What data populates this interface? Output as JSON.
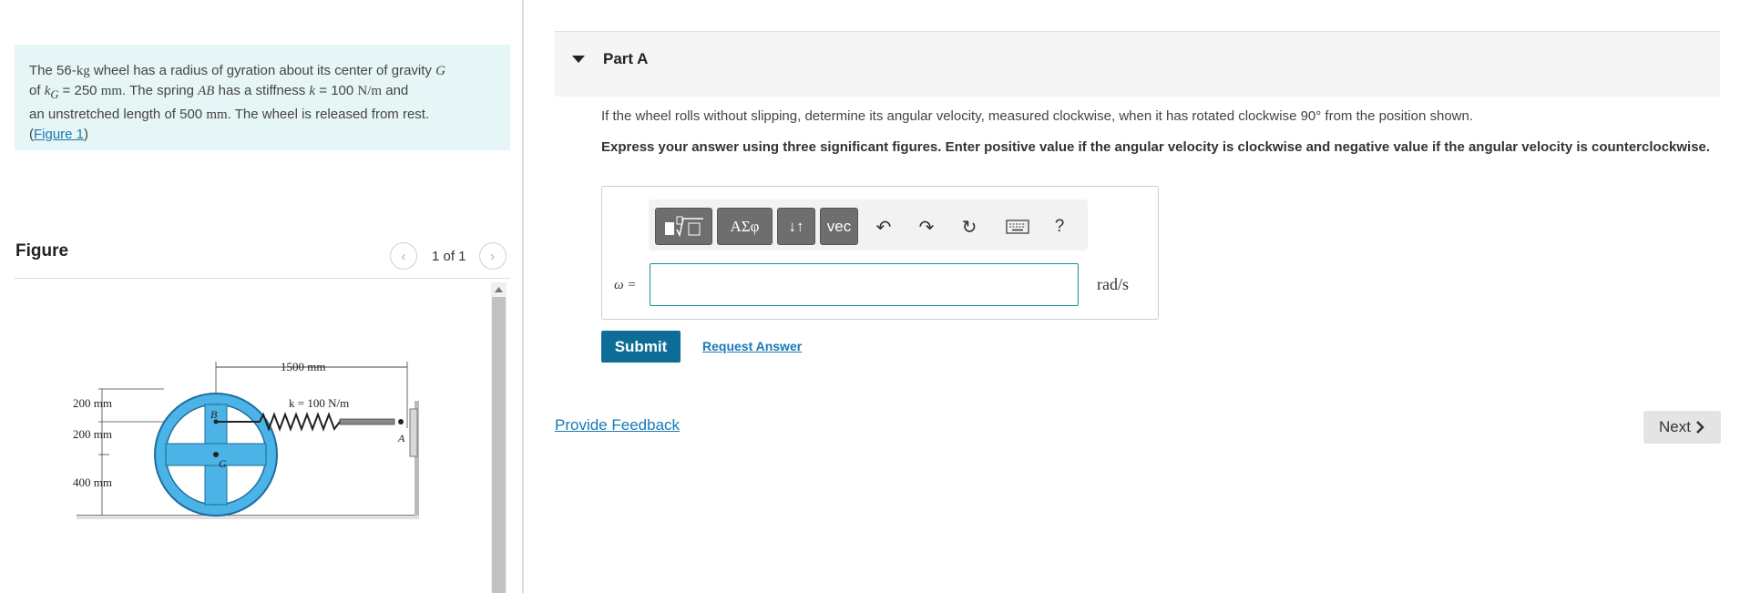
{
  "problem": {
    "text_1": "The 56-",
    "kg": "kg",
    "text_2": " wheel has a radius of gyration about its center of gravity ",
    "G": "G",
    "text_3": "of ",
    "kG_k": "k",
    "kG_sub": "G",
    "text_4": " = 250 ",
    "mm1": "mm",
    "text_5": ". The spring ",
    "AB": "AB",
    "text_6": " has a stiffness ",
    "k": "k",
    "text_7": " = 100 ",
    "Nm": "N/m",
    "text_8": " and",
    "text_9": "an unstretched length of 500 ",
    "mm2": "mm",
    "text_10": ". The wheel is released from rest.",
    "figure_link_open": "(",
    "figure_link": "Figure 1",
    "figure_link_close": ")"
  },
  "figure": {
    "heading": "Figure",
    "counter": "1 of 1",
    "labels": {
      "dim_top": "1500 mm",
      "stiffness": "k = 100 N/m",
      "dim_200a": "200 mm",
      "dim_200b": "200 mm",
      "dim_400": "400 mm",
      "point_B": "B",
      "point_G": "G",
      "point_A": "A"
    }
  },
  "part": {
    "title": "Part A",
    "question": "If the wheel rolls without slipping, determine its angular velocity, measured clockwise, when it has rotated clockwise 90° from the position shown.",
    "instructions": "Express your answer using three significant figures. Enter positive value if the angular velocity is clockwise and negative value if the angular velocity is counterclockwise.",
    "toolbar": {
      "templates_icon": "template-icon",
      "greek": "ΑΣφ",
      "arrows": "↓↑",
      "vec": "vec",
      "help": "?"
    },
    "answer": {
      "label": "ω =",
      "value": "",
      "unit": "rad/s"
    },
    "submit": "Submit",
    "request_answer": "Request Answer"
  },
  "footer": {
    "feedback": "Provide Feedback",
    "next": "Next"
  },
  "colors": {
    "accent": "#0e6d96",
    "link": "#1a79b5",
    "problem_bg": "#e6f5f5",
    "wheel": "#4cb3e6"
  }
}
